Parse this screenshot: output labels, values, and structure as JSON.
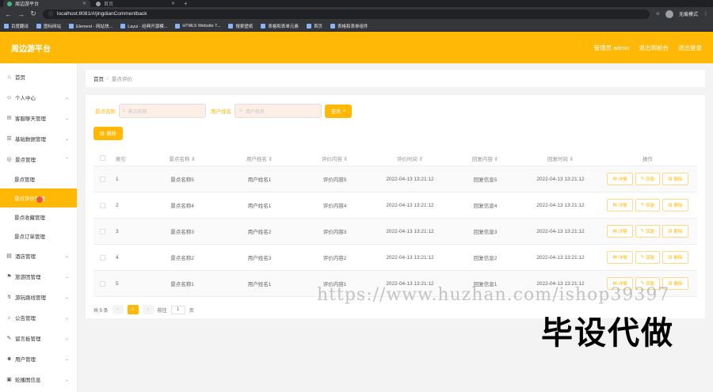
{
  "browser": {
    "tabs": [
      {
        "title": "周边游平台",
        "active": true
      },
      {
        "title": "首页",
        "active": false
      }
    ],
    "new_tab": "+",
    "address": "localhost:8081/#/jingdianCommentback",
    "profile_label": "无痕模式",
    "bookmarks": [
      {
        "label": "百度翻译"
      },
      {
        "label": "图标网站"
      },
      {
        "label": "Element - 网站快..."
      },
      {
        "label": "Layui - 经典开源模..."
      },
      {
        "label": "HTML5 Website T..."
      },
      {
        "label": "搜索壁纸"
      },
      {
        "label": "表格和表单元素"
      },
      {
        "label": "首页"
      },
      {
        "label": "表格和表单组件"
      }
    ]
  },
  "header": {
    "title": "周边游平台",
    "user_label": "管理员 admin",
    "exit_to_front": "退出到前台",
    "logout": "退出登录"
  },
  "sidebar": {
    "items": [
      {
        "label": "首页",
        "icon": "home-icon"
      },
      {
        "label": "个人中心",
        "icon": "user-icon"
      },
      {
        "label": "客服聊天管理",
        "icon": "chat-icon"
      },
      {
        "label": "基础数据管理",
        "icon": "database-icon"
      },
      {
        "label": "景点管理",
        "icon": "pin-icon"
      }
    ],
    "subitems": [
      {
        "label": "景点管理"
      },
      {
        "label": "景点评价管理"
      },
      {
        "label": "景点收藏管理"
      },
      {
        "label": "景点订单管理"
      }
    ],
    "items_after": [
      {
        "label": "酒店管理",
        "icon": "hotel-icon"
      },
      {
        "label": "旅游团管理",
        "icon": "group-icon"
      },
      {
        "label": "游玩路线管理",
        "icon": "route-icon"
      },
      {
        "label": "公告管理",
        "icon": "notice-icon"
      },
      {
        "label": "留言板管理",
        "icon": "message-icon"
      },
      {
        "label": "用户管理",
        "icon": "users-icon"
      },
      {
        "label": "轮播图信息",
        "icon": "image-icon"
      }
    ]
  },
  "breadcrumb": {
    "home": "首页",
    "sep": "/",
    "current": "景点评价"
  },
  "search": {
    "label1": "景点名称",
    "placeholder1": "景点名称",
    "label2": "用户姓名",
    "placeholder2": "用户姓名",
    "button": "查询"
  },
  "delete_button": "删除",
  "table": {
    "headers": [
      "索引",
      "景点名称",
      "用户姓名",
      "评价内容",
      "评价时间",
      "回复内容",
      "回复时间",
      "操作"
    ],
    "sort_glyph": "⇕",
    "rows": [
      {
        "idx": "1",
        "name": "景点名称5",
        "user": "用户姓名1",
        "content": "评价内容5",
        "time": "2022-04-13 13:21:12",
        "reply": "回复信息5",
        "reply_time": "2022-04-13 13:21:12"
      },
      {
        "idx": "2",
        "name": "景点名称4",
        "user": "用户姓名1",
        "content": "评价内容4",
        "time": "2022-04-13 13:21:12",
        "reply": "回复信息4",
        "reply_time": "2022-04-13 13:21:12"
      },
      {
        "idx": "3",
        "name": "景点名称3",
        "user": "用户姓名2",
        "content": "评价内容3",
        "time": "2022-04-13 13:21:12",
        "reply": "回复信息3",
        "reply_time": "2022-04-13 13:21:12"
      },
      {
        "idx": "4",
        "name": "景点名称2",
        "user": "用户姓名3",
        "content": "评价内容2",
        "time": "2022-04-13 13:21:12",
        "reply": "回复信息2",
        "reply_time": "2022-04-13 13:21:12"
      },
      {
        "idx": "5",
        "name": "景点名称1",
        "user": "用户姓名1",
        "content": "评价内容1",
        "time": "2022-04-13 13:21:12",
        "reply": "回复信息1",
        "reply_time": "2022-04-13 13:21:12"
      }
    ],
    "actions": {
      "detail": "详情",
      "reply": "回复",
      "delete": "删除"
    }
  },
  "pagination": {
    "total": "共 5 条",
    "prev": "‹",
    "current": "1",
    "next": "›",
    "goto": "前往",
    "page_value": "1",
    "page_unit": "页"
  },
  "overlay": {
    "watermark": "https://www.huzhan.com/ishop39397",
    "stamp": "毕设代做"
  },
  "colors": {
    "accent": "#ffb806",
    "browser_bg": "#35363a"
  }
}
